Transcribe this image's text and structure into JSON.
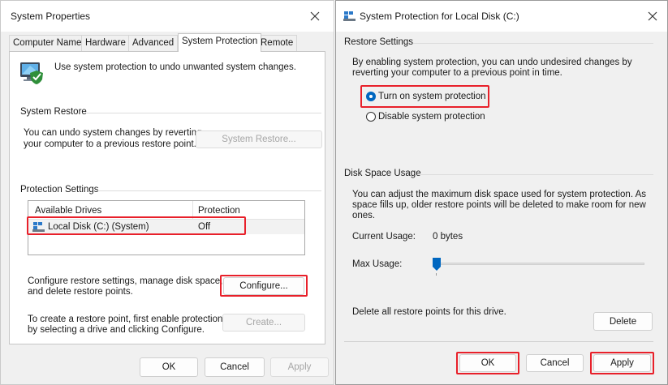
{
  "system_properties": {
    "title": "System Properties",
    "tabs": [
      {
        "label": "Computer Name"
      },
      {
        "label": "Hardware"
      },
      {
        "label": "Advanced"
      },
      {
        "label": "System Protection"
      },
      {
        "label": "Remote"
      }
    ],
    "intro_text": "Use system protection to undo unwanted system changes.",
    "system_restore": {
      "heading": "System Restore",
      "description_line1": "You can undo system changes by reverting",
      "description_line2": "your computer to a previous restore point.",
      "button_label": "System Restore..."
    },
    "protection_settings": {
      "heading": "Protection Settings",
      "columns": [
        "Available Drives",
        "Protection"
      ],
      "rows": [
        {
          "drive": "Local Disk (C:) (System)",
          "protection": "Off"
        }
      ],
      "configure_text_line1": "Configure restore settings, manage disk space,",
      "configure_text_line2": "and delete restore points.",
      "configure_button": "Configure...",
      "create_text_line1": "To create a restore point, first enable protection",
      "create_text_line2": "by selecting a drive and clicking Configure.",
      "create_button": "Create..."
    },
    "footer": {
      "ok": "OK",
      "cancel": "Cancel",
      "apply": "Apply"
    }
  },
  "protection_dialog": {
    "title": "System Protection for Local Disk (C:)",
    "restore_settings": {
      "heading": "Restore Settings",
      "description_line1": "By enabling system protection, you can undo undesired changes by",
      "description_line2": "reverting your computer to a previous point in time.",
      "option_on": "Turn on system protection",
      "option_off": "Disable system protection"
    },
    "disk_space": {
      "heading": "Disk Space Usage",
      "description_line1": "You can adjust the maximum disk space used for system protection. As",
      "description_line2": "space fills up, older restore points will be deleted to make room for new",
      "description_line3": "ones.",
      "current_usage_label": "Current Usage:",
      "current_usage_value": "0 bytes",
      "max_usage_label": "Max Usage:",
      "max_usage_fraction": 0.0,
      "delete_text": "Delete all restore points for this drive.",
      "delete_button": "Delete"
    },
    "footer": {
      "ok": "OK",
      "cancel": "Cancel",
      "apply": "Apply"
    }
  },
  "colors": {
    "highlight": "#e8202a",
    "accent": "#0067c0"
  }
}
